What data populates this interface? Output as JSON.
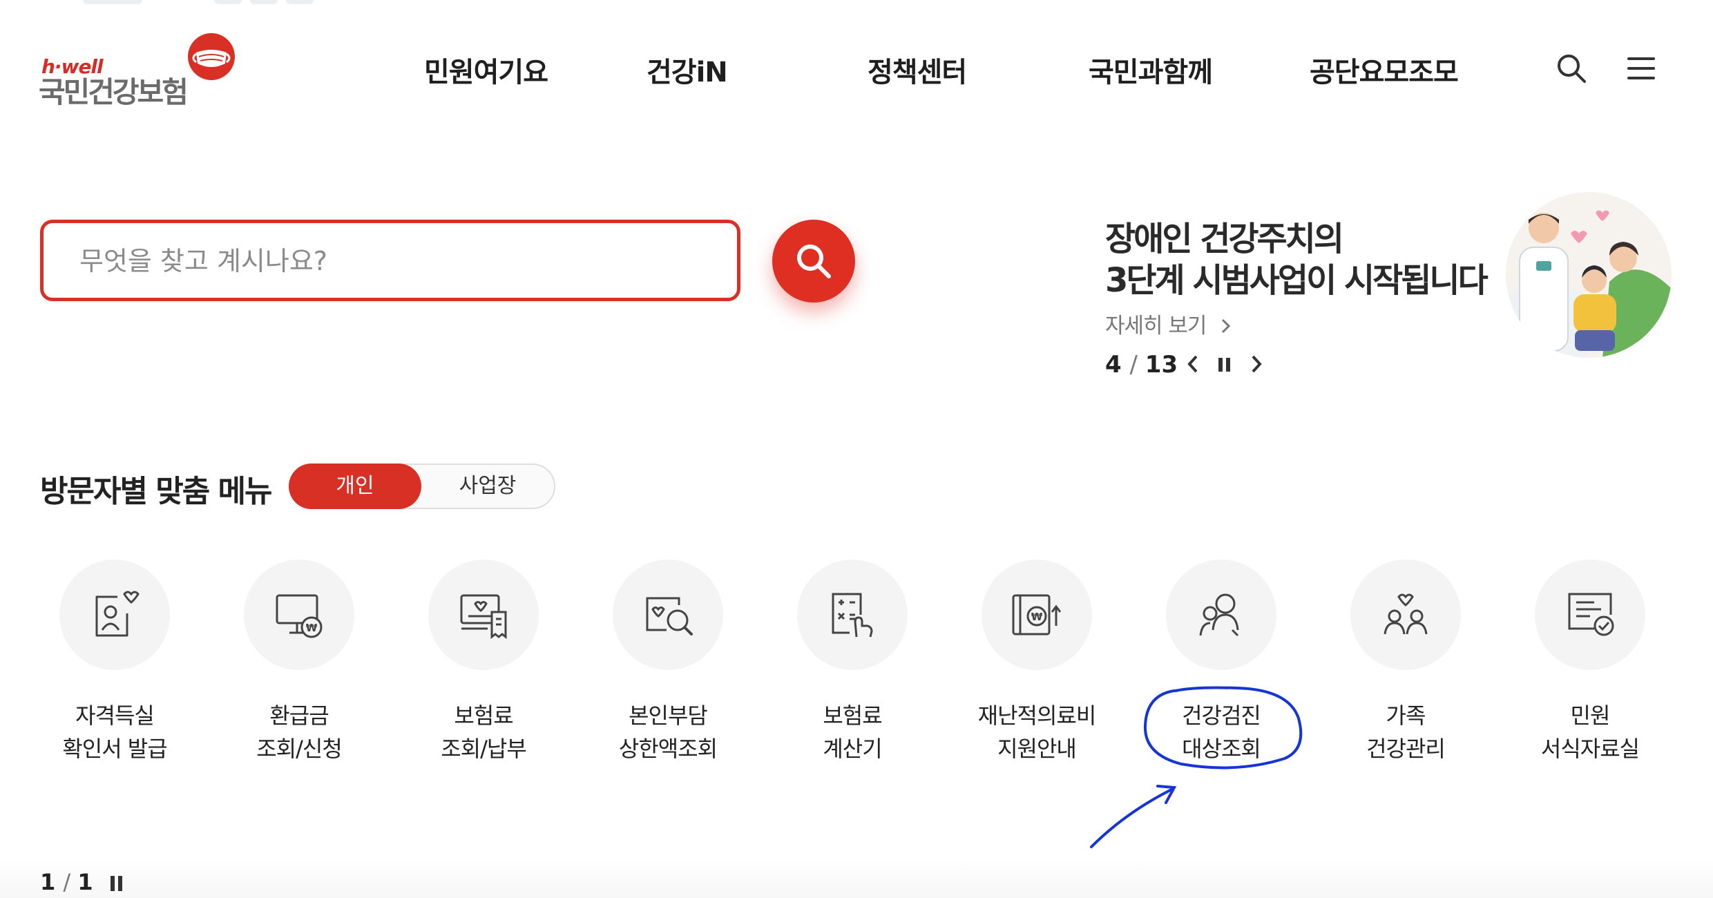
{
  "header": {
    "logo": {
      "small": "h·well",
      "main": "국민건강보험"
    },
    "nav": [
      "민원여기요",
      "건강iN",
      "정책센터",
      "국민과함께",
      "공단요모조모"
    ],
    "icons": {
      "search": "search-icon",
      "menu": "hamburger-menu-icon"
    }
  },
  "search": {
    "placeholder": "무엇을 찾고 계시나요?",
    "value": ""
  },
  "banner": {
    "title_line1": "장애인 건강주치의",
    "title_line2": "3단계 시범사업이 시작됩니다",
    "more": "자세히 보기",
    "current": "4",
    "total": "13"
  },
  "visitor_menu": {
    "title": "방문자별 맞춤 메뉴",
    "tabs": {
      "personal": "개인",
      "business": "사업장"
    },
    "active_tab": "개인",
    "items": [
      {
        "line1": "자격득실",
        "line2": "확인서 발급",
        "icon": "person-card-heart-icon"
      },
      {
        "line1": "환급금",
        "line2": "조회/신청",
        "icon": "monitor-won-icon"
      },
      {
        "line1": "보험료",
        "line2": "조회/납부",
        "icon": "receipt-heart-icon"
      },
      {
        "line1": "본인부담",
        "line2": "상한액조회",
        "icon": "heart-magnifier-icon"
      },
      {
        "line1": "보험료",
        "line2": "계산기",
        "icon": "calculator-hand-icon"
      },
      {
        "line1": "재난적의료비",
        "line2": "지원안내",
        "icon": "book-won-arrow-icon"
      },
      {
        "line1": "건강검진",
        "line2": "대상조회",
        "icon": "people-search-icon"
      },
      {
        "line1": "가족",
        "line2": "건강관리",
        "icon": "family-heart-icon"
      },
      {
        "line1": "민원",
        "line2": "서식자료실",
        "icon": "document-check-icon"
      }
    ],
    "pager": {
      "current": "1",
      "total": "1"
    }
  },
  "colors": {
    "accent": "#d93025",
    "annotation": "#1535d6"
  }
}
